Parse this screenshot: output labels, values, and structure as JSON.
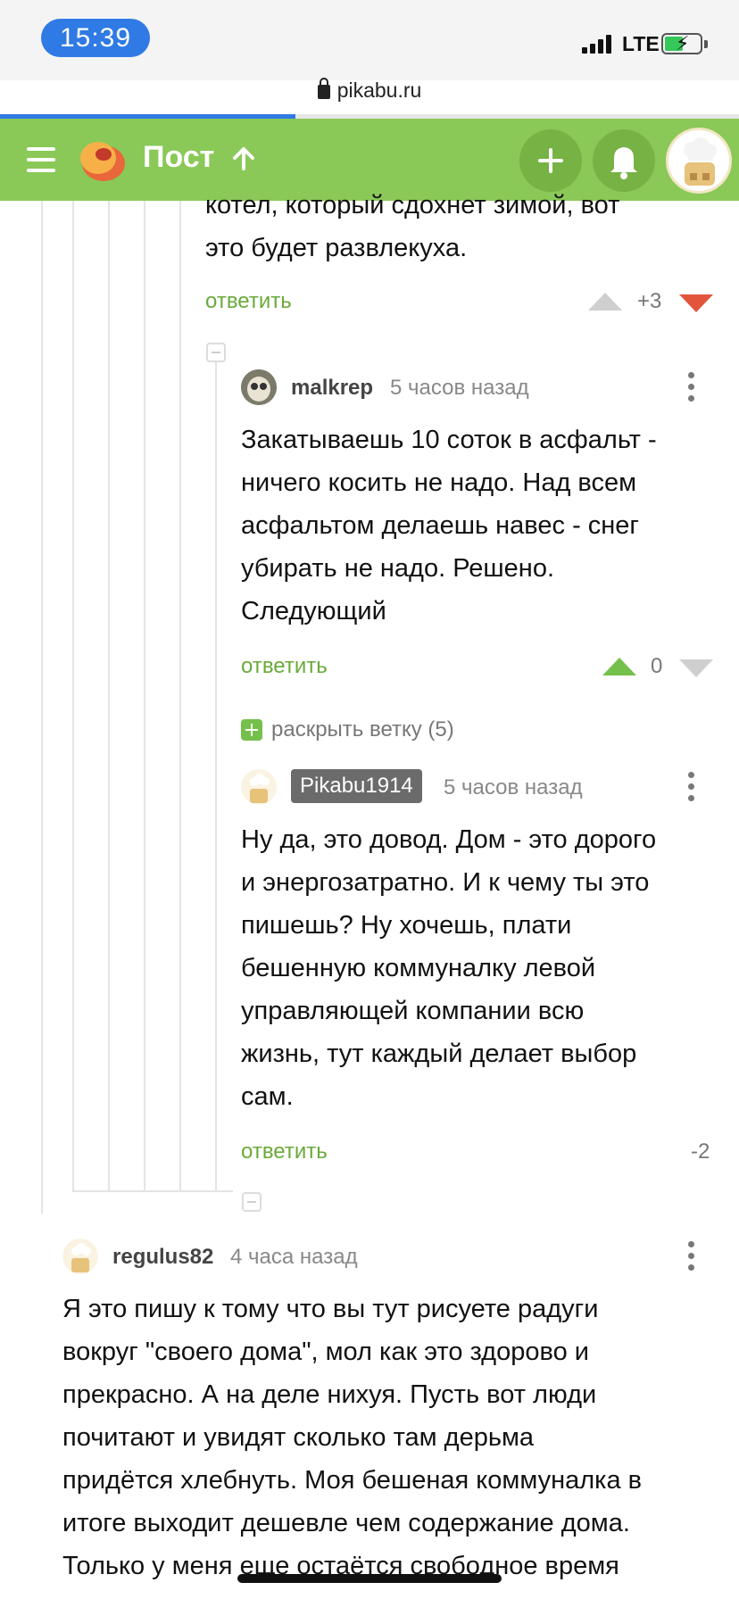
{
  "status_bar": {
    "time": "15:39",
    "network": "LTE"
  },
  "browser": {
    "url": "pikabu.ru",
    "load_progress": 0.4
  },
  "header": {
    "title": "Пост"
  },
  "comments": {
    "prev": {
      "text_line1": "котел, который сдохнет зимой, вот",
      "text_line2": "это будет развлекуха.",
      "reply": "ответить",
      "score": "+3"
    },
    "c1": {
      "user": "malkrep",
      "time": "5 часов назад",
      "lines": [
        "Закатываешь 10 соток в асфальт -",
        "ничего косить не надо. Над всем",
        "асфальтом делаешь навес - снег",
        "убирать не надо. Решено.",
        "Следующий"
      ],
      "reply": "ответить",
      "score": "0"
    },
    "expand": {
      "label": "раскрыть ветку (5)"
    },
    "c2": {
      "user": "Pikabu1914",
      "time": "5 часов назад",
      "lines": [
        "Ну да, это довод. Дом - это дорого",
        "и энергозатратно. И к чему ты это",
        "пишешь? Ну хочешь, плати",
        "бешенную коммуналку левой",
        "управляющей компании всю",
        "жизнь, тут каждый делает выбор",
        "сам."
      ],
      "reply": "ответить",
      "score": "-2"
    },
    "c3": {
      "user": "regulus82",
      "time": "4 часа назад",
      "lines": [
        "Я это пишу к тому что вы тут рисуете радуги",
        "вокруг \"своего дома\", мол как это здорово и",
        "прекрасно. А на деле нихуя. Пусть вот люди",
        "почитают и увидят сколько там дерьма",
        "придётся хлебнуть. Моя бешеная коммуналка в",
        "итоге выходит дешевле чем содержание дома.",
        "Только у меня еще остаётся свободное время"
      ]
    }
  },
  "colors": {
    "brand_green": "#8ac858",
    "link_green": "#6aaa3a",
    "upvote": "#75c04b",
    "downvote": "#e2553c",
    "status_blue": "#2f7ae5"
  }
}
